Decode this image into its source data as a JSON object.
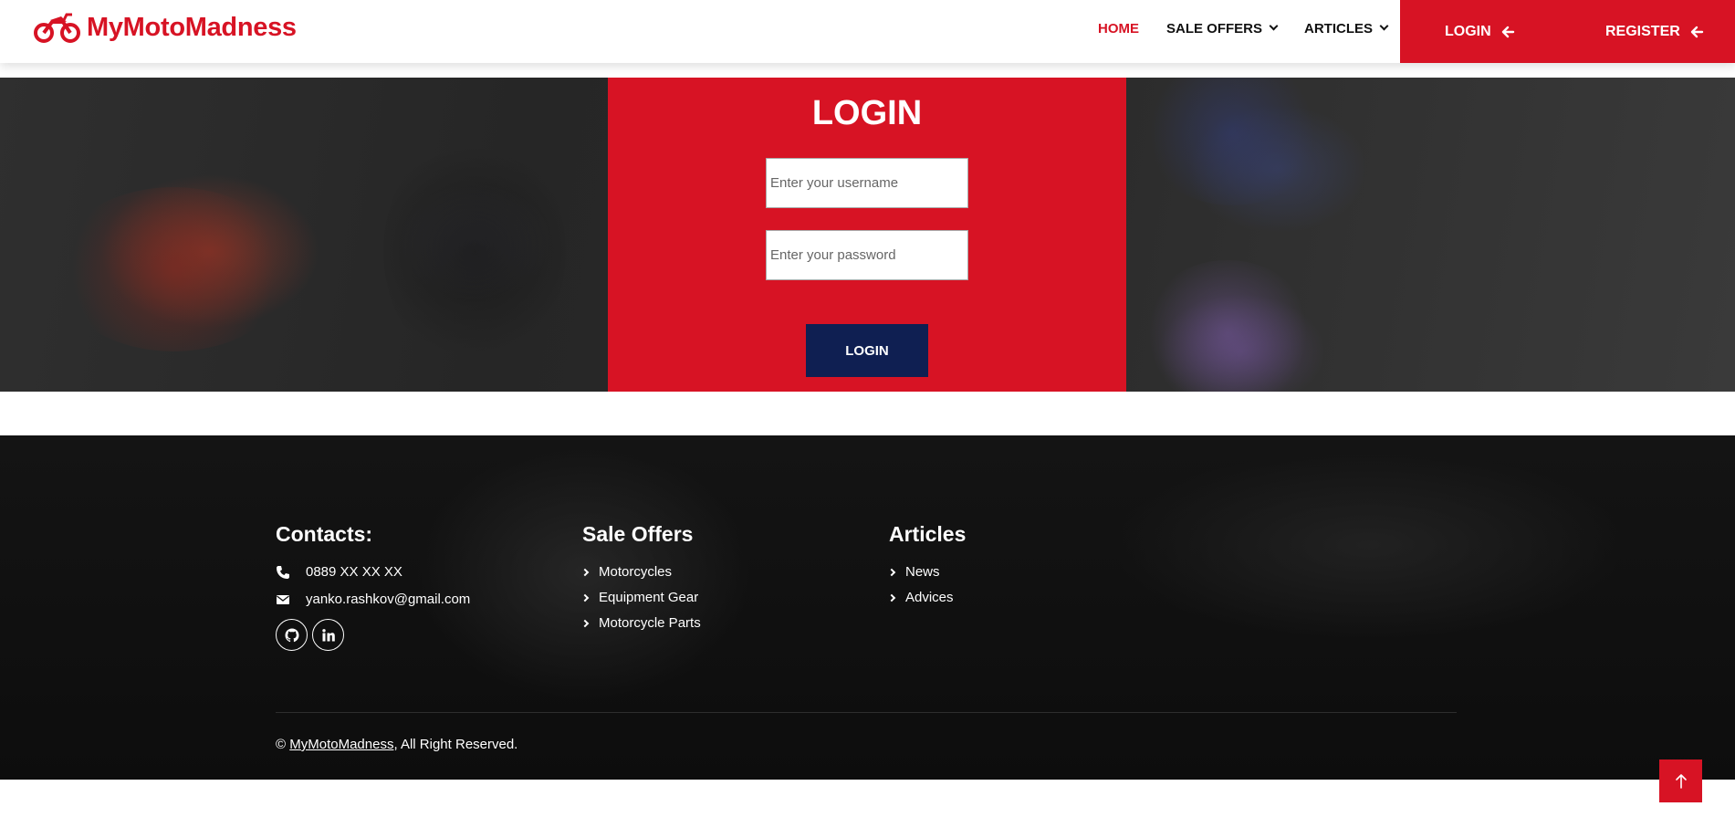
{
  "brand": {
    "name": "MyMotoMadness",
    "color": "#d71324"
  },
  "nav": {
    "items": [
      {
        "label": "HOME",
        "active": true
      },
      {
        "label": "SALE OFFERS",
        "dropdown": true
      },
      {
        "label": "ARTICLES",
        "dropdown": true
      }
    ],
    "login_label": "LOGIN",
    "register_label": "REGISTER"
  },
  "login_form": {
    "title": "LOGIN",
    "username_placeholder": "Enter your username",
    "password_placeholder": "Enter your password",
    "submit_label": "LOGIN"
  },
  "footer": {
    "contacts": {
      "title": "Contacts:",
      "phone": "0889 XX XX XX",
      "email": "yanko.rashkov@gmail.com",
      "social": [
        "github-icon",
        "linkedin-icon"
      ]
    },
    "sale_offers": {
      "title": "Sale Offers",
      "links": [
        "Motorcycles",
        "Equipment Gear",
        "Motorcycle Parts"
      ]
    },
    "articles": {
      "title": "Articles",
      "links": [
        "News",
        "Advices"
      ]
    },
    "copyright": {
      "prefix": "© ",
      "brand": "MyMotoMadness",
      "suffix": ", All Right Reserved."
    }
  },
  "colors": {
    "accent": "#d71324",
    "button_dark": "#0f1f52",
    "footer_bg": "#111111"
  }
}
